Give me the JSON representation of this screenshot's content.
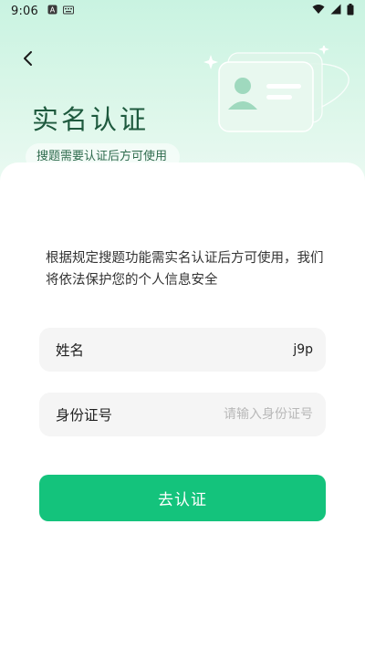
{
  "status_bar": {
    "time": "9:06",
    "left_icons": [
      "a-notification-icon",
      "keyboard-icon"
    ],
    "right_icons": [
      "wifi-icon",
      "signal-icon",
      "battery-icon"
    ]
  },
  "header": {
    "back_icon": "chevron-left-icon",
    "title": "实名认证",
    "subtitle": "搜题需要认证后方可使用",
    "illustration": "id-card-icon"
  },
  "main": {
    "description": "根据规定搜题功能需实名认证后方可使用，我们将依法保护您的个人信息安全",
    "form": {
      "name": {
        "label": "姓名",
        "value": "j9p",
        "placeholder": ""
      },
      "id_number": {
        "label": "身份证号",
        "value": "",
        "placeholder": "请输入身份证号"
      }
    },
    "submit_label": "去认证"
  },
  "colors": {
    "accent": "#14c37c",
    "title": "#1e5a3e",
    "hero_top": "#c9f3e1",
    "field_bg": "#f5f5f5"
  }
}
